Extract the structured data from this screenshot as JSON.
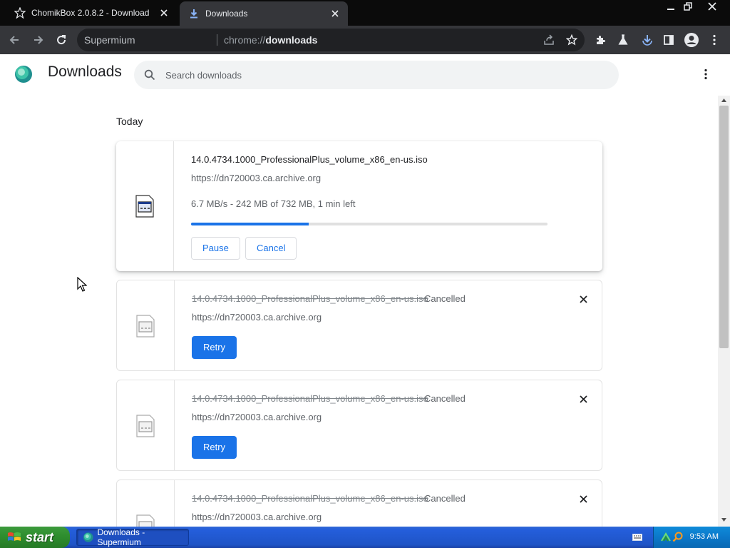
{
  "tabs": [
    {
      "title": "ChomikBox 2.0.8.2 - Download",
      "active": false
    },
    {
      "title": "Downloads",
      "active": true
    }
  ],
  "toolbar": {
    "site_label": "Supermium",
    "url_prefix": "chrome://",
    "url_host": "downloads"
  },
  "page": {
    "title": "Downloads",
    "search_placeholder": "Search downloads",
    "date_header": "Today"
  },
  "downloads": [
    {
      "filename": "14.0.4734.1000_ProfessionalPlus_volume_x86_en-us.iso",
      "url": "https://dn720003.ca.archive.org",
      "progress_text": "6.7 MB/s - 242 MB of 732 MB, 1 min left",
      "progress_fraction": 0.33,
      "pause_label": "Pause",
      "cancel_label": "Cancel"
    },
    {
      "filename": "14.0.4734.1000_ProfessionalPlus_volume_x86_en-us.iso",
      "status": "Cancelled",
      "url": "https://dn720003.ca.archive.org",
      "retry_label": "Retry"
    },
    {
      "filename": "14.0.4734.1000_ProfessionalPlus_volume_x86_en-us.iso",
      "status": "Cancelled",
      "url": "https://dn720003.ca.archive.org",
      "retry_label": "Retry"
    },
    {
      "filename": "14.0.4734.1000_ProfessionalPlus_volume_x86_en-us.iso",
      "status": "Cancelled",
      "url": "https://dn720003.ca.archive.org"
    }
  ],
  "taskbar": {
    "start_label": "start",
    "window_item": "Downloads - Supermium",
    "clock": "9:53 AM"
  },
  "colors": {
    "accent": "#1a73e8",
    "tabstrip": "#0b0b0b",
    "toolbar": "#35363a",
    "taskbar": "#245edb",
    "start_green": "#2f8f2f"
  }
}
